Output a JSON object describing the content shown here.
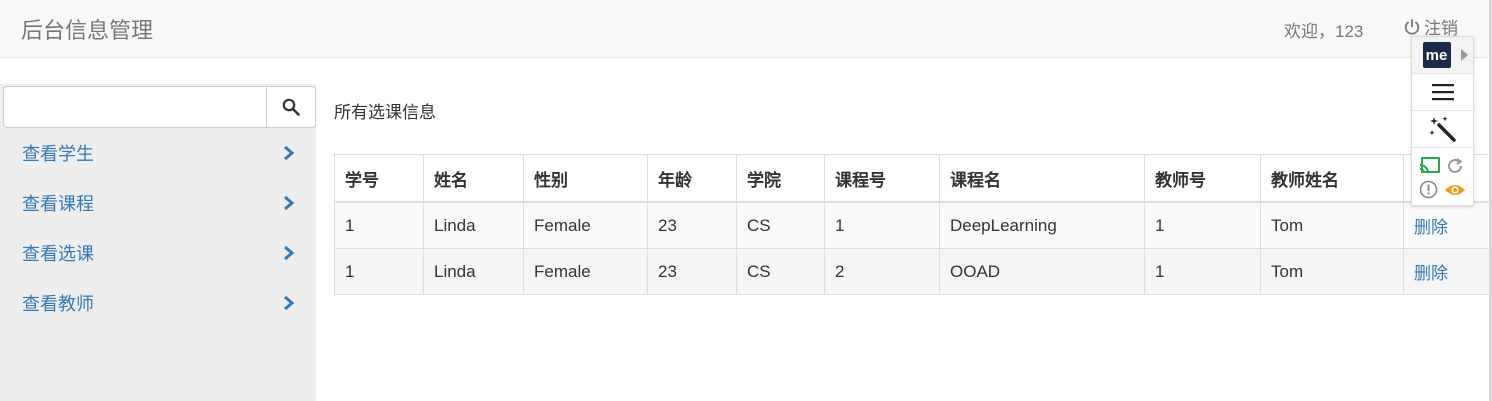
{
  "header": {
    "brand": "后台信息管理",
    "welcome": "欢迎，123",
    "logout_label": "注销",
    "logout_icon": "power-icon"
  },
  "sidebar": {
    "search_placeholder": "",
    "search_icon": "search-icon",
    "items": [
      {
        "label": "查看学生"
      },
      {
        "label": "查看课程"
      },
      {
        "label": "查看选课"
      },
      {
        "label": "查看教师"
      }
    ]
  },
  "main": {
    "title": "所有选课信息",
    "columns": [
      "学号",
      "姓名",
      "性别",
      "年龄",
      "学院",
      "课程号",
      "课程名",
      "教师号",
      "教师姓名",
      ""
    ],
    "rows": [
      [
        "1",
        "Linda",
        "Female",
        "23",
        "CS",
        "1",
        "DeepLearning",
        "1",
        "Tom",
        "删除"
      ],
      [
        "1",
        "Linda",
        "Female",
        "23",
        "CS",
        "2",
        "OOAD",
        "1",
        "Tom",
        "删除"
      ]
    ]
  },
  "extension_panel": {
    "logo_text": "me",
    "icons": [
      "menu-icon",
      "magic-wand-icon",
      "cast-icon",
      "refresh-icon",
      "info-icon",
      "eye-icon"
    ]
  },
  "colors": {
    "link": "#337ab7",
    "navbar_bg": "#f8f8f8",
    "sidebar_bg": "#eeeeee",
    "extension_logo_bg": "#1a2a47",
    "eye_icon": "#f0a020",
    "cast_icon": "#2aa84a"
  }
}
